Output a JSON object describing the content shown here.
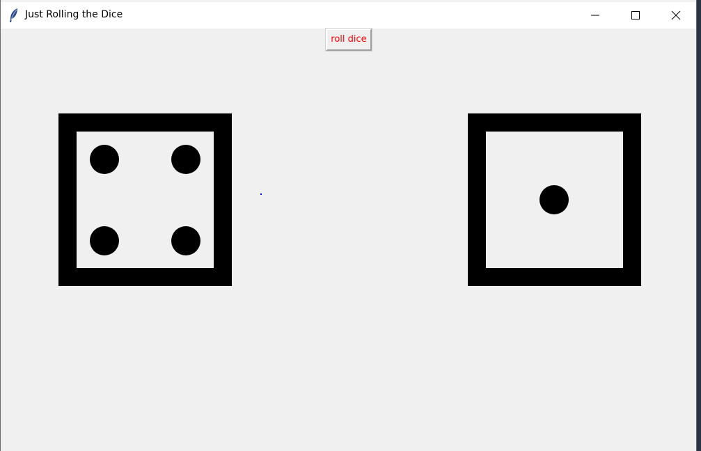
{
  "window": {
    "title": "Just Rolling the Dice",
    "icon": "feather-icon",
    "controls": [
      "minimize-icon",
      "maximize-icon",
      "close-icon"
    ]
  },
  "toolbar": {
    "roll_label": "roll dice",
    "roll_color": "#ff0000"
  },
  "dice": [
    {
      "value": 4
    },
    {
      "value": 1
    }
  ],
  "colors": {
    "background": "#f0f0f0",
    "die_border": "#000000",
    "pip": "#000000",
    "marker": "#0000ff"
  }
}
